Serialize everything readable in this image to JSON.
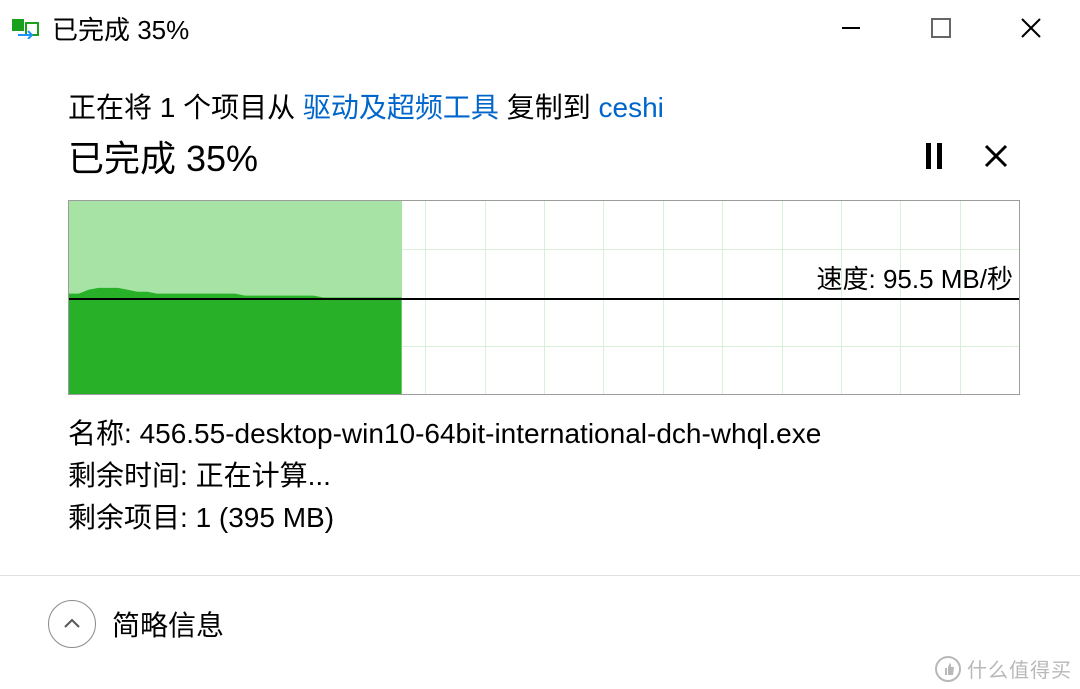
{
  "titlebar": {
    "title": "已完成 35%"
  },
  "description": {
    "prefix": "正在将 1 个项目从 ",
    "source": "驱动及超频工具",
    "middle": " 复制到 ",
    "destination": "ceshi"
  },
  "progress": {
    "title": "已完成 35%",
    "percent": 35
  },
  "chart_data": {
    "type": "area",
    "progress_percent": 35,
    "speed_label": "速度: 95.5 MB/秒",
    "speed_line_position_percent": 50,
    "columns": 16,
    "rows": 4,
    "history_percent": [
      52,
      52,
      54,
      55,
      55,
      55,
      54,
      53,
      53,
      52,
      52,
      52,
      52,
      52,
      52,
      52,
      52,
      52,
      51,
      51,
      51,
      51,
      51,
      51,
      51,
      51,
      50,
      50,
      50,
      50,
      50,
      50,
      50,
      50,
      50
    ]
  },
  "info": {
    "name_label": "名称: ",
    "name_value": "456.55-desktop-win10-64bit-international-dch-whql.exe",
    "time_label": "剩余时间: ",
    "time_value": "正在计算...",
    "items_label": "剩余项目: ",
    "items_value": "1 (395 MB)"
  },
  "footer": {
    "toggle_label": "简略信息"
  },
  "watermark": {
    "text": "什么值得买"
  }
}
